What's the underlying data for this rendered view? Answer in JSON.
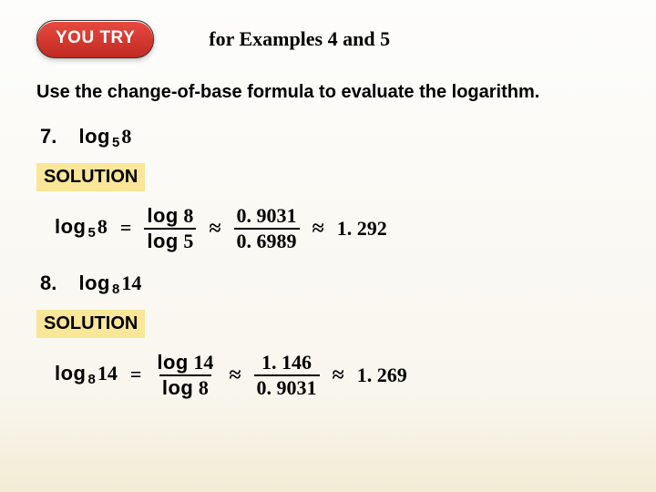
{
  "header": {
    "badge": "YOU TRY",
    "subtitle": "for Examples 4 and 5"
  },
  "instruction": "Use the change-of-base formula to evaluate the logarithm.",
  "p7": {
    "num": "7.",
    "logword": "log",
    "base": "5",
    "arg": "8",
    "solution_label": "SOLUTION",
    "lhs_log": "log",
    "lhs_base": "5",
    "lhs_arg": "8",
    "eq": "=",
    "frac1_top_log": "log",
    "frac1_top_arg": "8",
    "frac1_bot_log": "log",
    "frac1_bot_arg": "5",
    "approx1": "≈",
    "frac2_top": "0. 9031",
    "frac2_bot": "0. 6989",
    "approx2": "≈",
    "result": "1. 292"
  },
  "p8": {
    "num": "8.",
    "logword": "log",
    "base": "8",
    "arg": "14",
    "solution_label": "SOLUTION",
    "lhs_log": "log",
    "lhs_base": "8",
    "lhs_arg": "14",
    "eq": "=",
    "frac1_top_log": "log",
    "frac1_top_arg": "14",
    "frac1_bot_log": "log",
    "frac1_bot_arg": "8",
    "approx1": "≈",
    "frac2_top": "1. 146",
    "frac2_bot": "0. 9031",
    "approx2": "≈",
    "result": "1. 269"
  }
}
